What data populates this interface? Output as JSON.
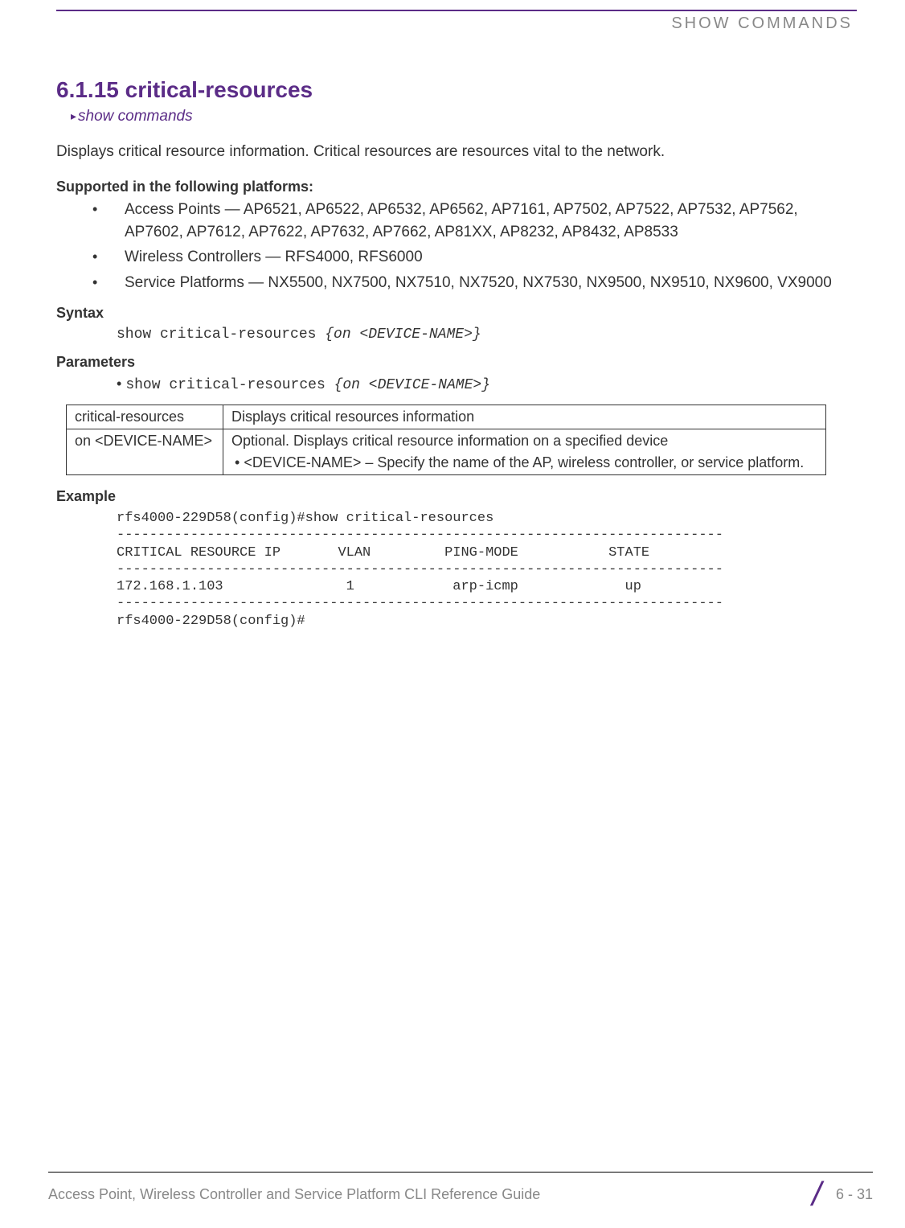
{
  "header": {
    "chapter_label": "SHOW COMMANDS"
  },
  "section": {
    "number_title": "6.1.15 critical-resources",
    "breadcrumb": "show commands",
    "description": "Displays critical resource information. Critical resources are resources vital to the network."
  },
  "platforms": {
    "heading": "Supported in the following platforms:",
    "items": [
      "Access Points — AP6521, AP6522, AP6532, AP6562, AP7161, AP7502, AP7522, AP7532, AP7562, AP7602, AP7612, AP7622, AP7632, AP7662, AP81XX, AP8232, AP8432, AP8533",
      "Wireless Controllers — RFS4000, RFS6000",
      "Service Platforms — NX5500, NX7500, NX7510, NX7520, NX7530, NX9500, NX9510, NX9600, VX9000"
    ]
  },
  "syntax": {
    "heading": "Syntax",
    "command": "show critical-resources ",
    "param": "{on <DEVICE-NAME>}"
  },
  "parameters": {
    "heading": "Parameters",
    "command": "show critical-resources ",
    "param": "{on <DEVICE-NAME>}",
    "table": {
      "row1_col1": "critical-resources",
      "row1_col2": "Displays critical resources information",
      "row2_col1": "on <DEVICE-NAME>",
      "row2_col2_line1": "Optional. Displays critical resource information on a specified device",
      "row2_col2_line2": "<DEVICE-NAME> – Specify the name of the AP, wireless controller, or service platform."
    }
  },
  "example": {
    "heading": "Example",
    "output": "rfs4000-229D58(config)#show critical-resources\n--------------------------------------------------------------------------\nCRITICAL RESOURCE IP       VLAN         PING-MODE           STATE\n--------------------------------------------------------------------------\n172.168.1.103               1            arp-icmp             up\n--------------------------------------------------------------------------\nrfs4000-229D58(config)#"
  },
  "footer": {
    "left": "Access Point, Wireless Controller and Service Platform CLI Reference Guide",
    "page": "6 - 31"
  }
}
